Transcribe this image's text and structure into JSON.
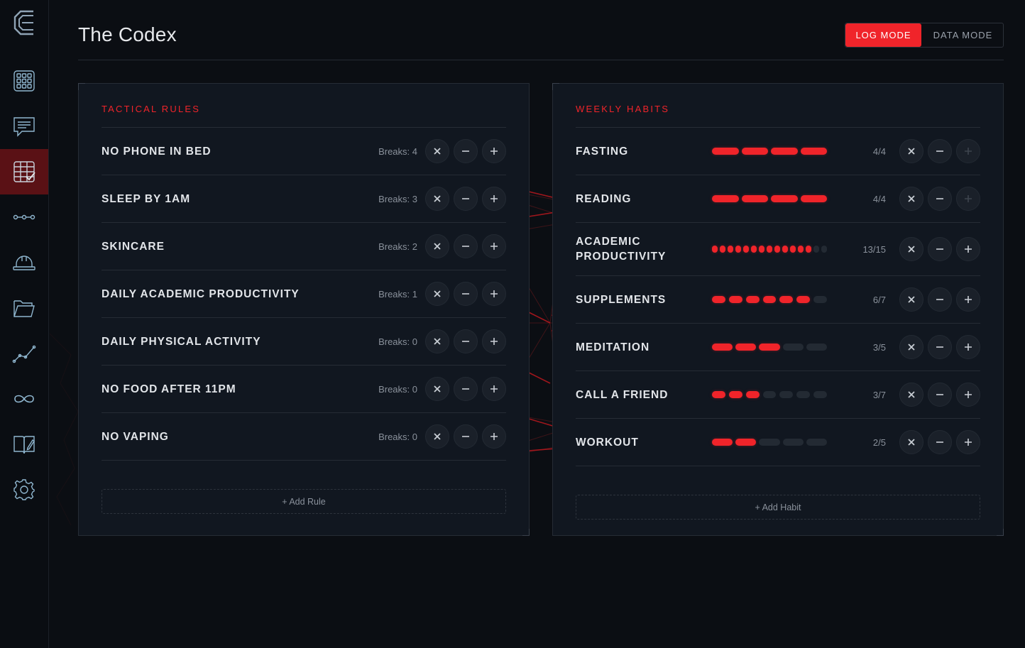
{
  "app": {
    "title": "The Codex",
    "accent": "#f0242a",
    "background": "#0b0e13",
    "panel_bg": "#111720"
  },
  "sidebar": {
    "logo": "codex-logo",
    "items": [
      {
        "name": "grid-icon",
        "active": false
      },
      {
        "name": "chat-icon",
        "active": false
      },
      {
        "name": "checklist-table-icon",
        "active": true
      },
      {
        "name": "timeline-icon",
        "active": false
      },
      {
        "name": "hard-hat-icon",
        "active": false
      },
      {
        "name": "folder-icon",
        "active": false
      },
      {
        "name": "trend-chart-icon",
        "active": false
      },
      {
        "name": "infinity-icon",
        "active": false
      },
      {
        "name": "journal-pen-icon",
        "active": false
      },
      {
        "name": "gear-icon",
        "active": false
      }
    ]
  },
  "mode_switch": {
    "log_label": "LOG MODE",
    "data_label": "DATA MODE",
    "selected": "LOG MODE"
  },
  "rules": {
    "title": "TACTICAL RULES",
    "items": [
      {
        "name": "NO PHONE IN BED",
        "breaks": "Breaks: 4"
      },
      {
        "name": "SLEEP BY 1AM",
        "breaks": "Breaks: 3"
      },
      {
        "name": "SKINCARE",
        "breaks": "Breaks: 2"
      },
      {
        "name": "DAILY ACADEMIC PRODUCTIVITY",
        "breaks": "Breaks: 1"
      },
      {
        "name": "DAILY PHYSICAL ACTIVITY",
        "breaks": "Breaks: 0"
      },
      {
        "name": "NO FOOD AFTER 11PM",
        "breaks": "Breaks: 0"
      },
      {
        "name": "NO VAPING",
        "breaks": "Breaks: 0"
      }
    ],
    "add_label": "+ Add Rule"
  },
  "habits": {
    "title": "WEEKLY HABITS",
    "items": [
      {
        "name": "FASTING",
        "done": 4,
        "target": 4,
        "count": "4/4",
        "plus_disabled": true
      },
      {
        "name": "READING",
        "done": 4,
        "target": 4,
        "count": "4/4",
        "plus_disabled": true
      },
      {
        "name": "ACADEMIC PRODUCTIVITY",
        "done": 13,
        "target": 15,
        "count": "13/15",
        "plus_disabled": false
      },
      {
        "name": "SUPPLEMENTS",
        "done": 6,
        "target": 7,
        "count": "6/7",
        "plus_disabled": false
      },
      {
        "name": "MEDITATION",
        "done": 3,
        "target": 5,
        "count": "3/5",
        "plus_disabled": false
      },
      {
        "name": "CALL A FRIEND",
        "done": 3,
        "target": 7,
        "count": "3/7",
        "plus_disabled": false
      },
      {
        "name": "WORKOUT",
        "done": 2,
        "target": 5,
        "count": "2/5",
        "plus_disabled": false
      }
    ],
    "add_label": "+ Add Habit"
  }
}
